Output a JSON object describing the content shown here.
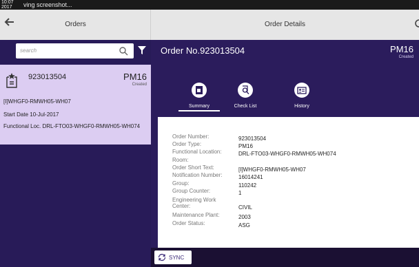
{
  "statusbar": {
    "time": "10:07\n2017",
    "notice": "ving screenshot..."
  },
  "left_header": {
    "title": "Orders",
    "back_icon": "arrow-left-icon"
  },
  "right_header": {
    "title": "Order Details",
    "refresh_icon": "refresh-icon"
  },
  "search": {
    "placeholder": "search",
    "search_icon": "search-icon",
    "filter_icon": "filter-icon"
  },
  "order_card": {
    "icon": "starred-clipboard-icon",
    "number": "923013504",
    "type": "PM16",
    "status": "Created",
    "description": "[I]WHGF0-RMWH05-WH07",
    "start_date": "Start Date 10-Jul-2017",
    "functional_location": "Functional Loc. DRL-FTO03-WHGF0-RMWH05-WH074"
  },
  "order_header": {
    "title": "Order No.923013504",
    "type": "PM16",
    "status": "Created"
  },
  "tabs": [
    {
      "label": "Summary",
      "icon": "summary-icon"
    },
    {
      "label": "Check List",
      "icon": "checklist-search-icon"
    },
    {
      "label": "History",
      "icon": "history-card-icon"
    }
  ],
  "details": [
    {
      "label": "Order Number:",
      "value": "923013504"
    },
    {
      "label": "Order Type:",
      "value": "PM16"
    },
    {
      "label": "Functional Location:",
      "value": "DRL-FTO03-WHGF0-RMWH05-WH074"
    },
    {
      "label": "Room:",
      "value": ""
    },
    {
      "label": "Order Short Text:",
      "value": "[I]WHGF0-RMWH05-WH07"
    },
    {
      "label": "Notification Number:",
      "value": "16014241"
    },
    {
      "label": "Group:",
      "value": "110242"
    },
    {
      "label": "Group Counter:",
      "value": "1"
    },
    {
      "label": "Engineering Work Center:",
      "value": "CIVIL"
    },
    {
      "label": "Maintenance Plant:",
      "value": "2003"
    },
    {
      "label": "Order Status:",
      "value": "ASG"
    }
  ],
  "sync": {
    "label": "SYNC",
    "icon": "sync-icon"
  },
  "colors": {
    "panel_purple": "#2b1c5c",
    "card_lavender": "#dccdf2",
    "header_gray": "#e6e6e6"
  }
}
